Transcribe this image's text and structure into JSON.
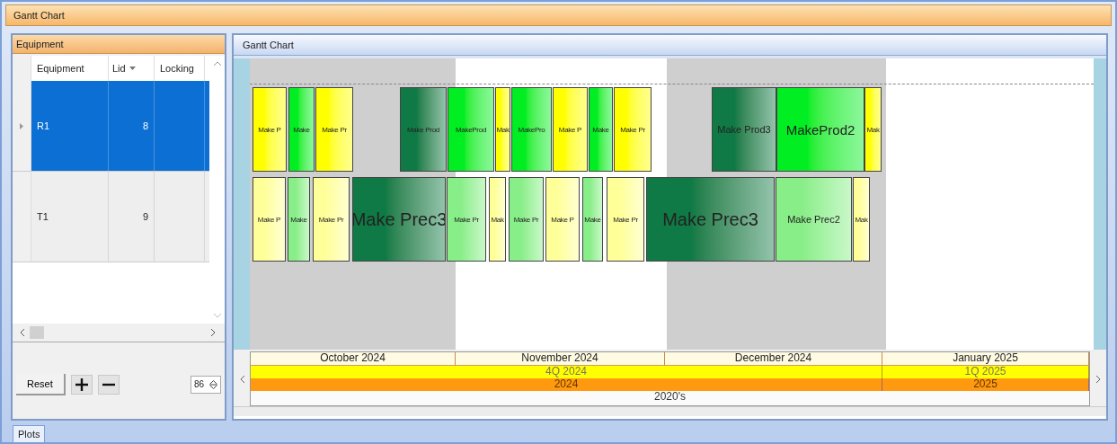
{
  "window": {
    "title": "Gantt Chart"
  },
  "equipment_panel": {
    "title": "Equipment",
    "columns": [
      {
        "label": "Equipment"
      },
      {
        "label": "Lid"
      },
      {
        "label": "Locking"
      }
    ],
    "rows": [
      {
        "equipment": "R1",
        "lid": "8",
        "selected": true
      },
      {
        "equipment": "T1",
        "lid": "9",
        "selected": false
      }
    ],
    "reset_button": "Reset",
    "zoom_value": "86"
  },
  "gantt_panel": {
    "title": "Gantt Chart",
    "rows": [
      {
        "bars": [
          {
            "label": "Make P",
            "color": "#ffff00"
          },
          {
            "label": "Make",
            "color": "#00ee22"
          },
          {
            "label": "Make Pr",
            "color": "#ffff00"
          },
          {
            "label": "Make Prod",
            "color": "#0f7a45"
          },
          {
            "label": "MakeProd",
            "color": "#00ee22"
          },
          {
            "label": "Mak",
            "color": "#ffff00"
          },
          {
            "label": "MakePro",
            "color": "#00ee22"
          },
          {
            "label": "Make P",
            "color": "#ffff00"
          },
          {
            "label": "Make",
            "color": "#00ee22"
          },
          {
            "label": "Make Pr",
            "color": "#ffff00"
          },
          {
            "label": "Make Prod3",
            "color": "#0f7a45"
          },
          {
            "label": "MakeProd2",
            "color": "#00ee22"
          },
          {
            "label": "Mak",
            "color": "#ffff00"
          }
        ]
      },
      {
        "bars": [
          {
            "label": "Make P",
            "color": "#ffff99"
          },
          {
            "label": "Make",
            "color": "#88ee88"
          },
          {
            "label": "Make Pr",
            "color": "#ffff99"
          },
          {
            "label": "Make Prec3",
            "color": "#0f7a45"
          },
          {
            "label": "Make Pr",
            "color": "#88ee88"
          },
          {
            "label": "Mak",
            "color": "#ffff99"
          },
          {
            "label": "Make Pr",
            "color": "#88ee88"
          },
          {
            "label": "Make P",
            "color": "#ffff99"
          },
          {
            "label": "Make",
            "color": "#88ee88"
          },
          {
            "label": "Make Pr",
            "color": "#ffff99"
          },
          {
            "label": "Make Prec3",
            "color": "#0f7a45"
          },
          {
            "label": "Make Prec2",
            "color": "#88ee88"
          },
          {
            "label": "Mak",
            "color": "#ffff99"
          }
        ]
      }
    ],
    "timescale": {
      "months": [
        "October 2024",
        "November 2024",
        "December 2024",
        "January 2025"
      ],
      "quarters": [
        "4Q 2024",
        "1Q 2025"
      ],
      "years": [
        "2024",
        "2025"
      ],
      "decade": "2020's"
    }
  },
  "bottom_tabs": [
    {
      "label": "Plots",
      "selected": true
    }
  ]
}
